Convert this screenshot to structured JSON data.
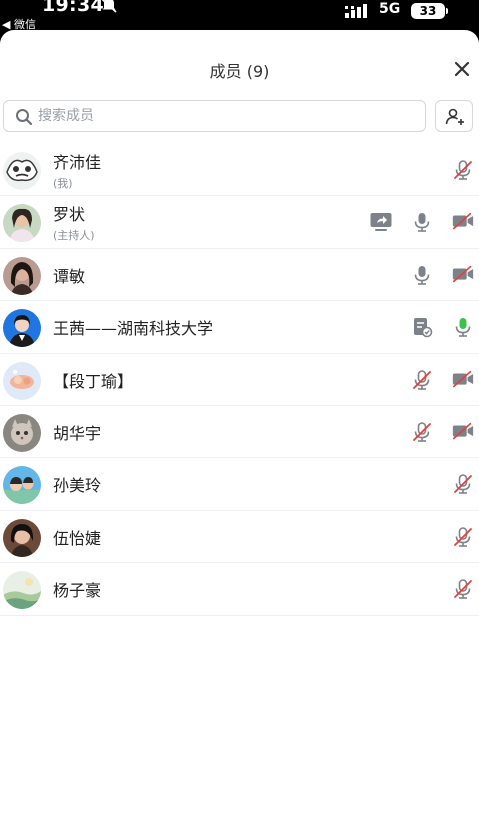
{
  "status_bar": {
    "time": "19:34",
    "back_app": "◀ 微信",
    "network": "5G",
    "battery": "33"
  },
  "header": {
    "title": "成员 (9)"
  },
  "search": {
    "placeholder": "搜索成员"
  },
  "members": [
    {
      "name": "齐沛佳",
      "role": "(我)",
      "icons": [
        "mic-off-icon"
      ]
    },
    {
      "name": "罗状",
      "role": "(主持人)",
      "icons": [
        "screen-share-icon",
        "mic-icon",
        "camera-off-icon"
      ]
    },
    {
      "name": "谭敏",
      "role": "",
      "icons": [
        "mic-icon",
        "camera-off-icon"
      ]
    },
    {
      "name": "王茜——湖南科技大学",
      "role": "",
      "icons": [
        "document-icon",
        "mic-active-icon"
      ]
    },
    {
      "name": "【段丁瑜】",
      "role": "",
      "icons": [
        "mic-off-icon",
        "camera-off-icon"
      ]
    },
    {
      "name": "胡华宇",
      "role": "",
      "icons": [
        "mic-off-icon",
        "camera-off-icon"
      ]
    },
    {
      "name": "孙美玲",
      "role": "",
      "icons": [
        "mic-off-icon"
      ]
    },
    {
      "name": "伍怡婕",
      "role": "",
      "icons": [
        "mic-off-icon"
      ]
    },
    {
      "name": "杨子豪",
      "role": "",
      "icons": [
        "mic-off-icon"
      ]
    }
  ],
  "colors": {
    "muted_red": "#e0413a",
    "icon_gray": "#7d828a",
    "active_green": "#3cc24a"
  }
}
